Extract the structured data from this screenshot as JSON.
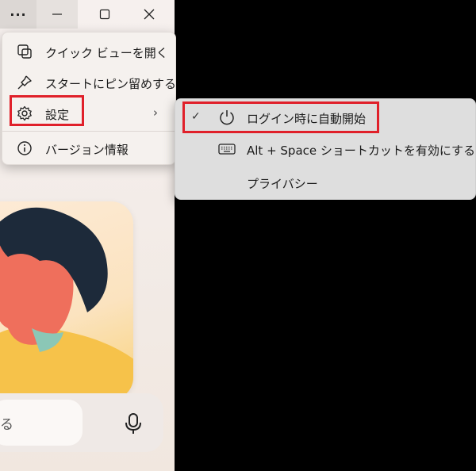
{
  "titlebar": {
    "more_label": "···",
    "minimize_label": "—",
    "maximize_label": "☐",
    "close_label": "✕"
  },
  "menu": {
    "items": [
      {
        "label": "クイック ビューを開く",
        "icon": "quick-view-icon"
      },
      {
        "label": "スタートにピン留めする",
        "icon": "pin-icon"
      },
      {
        "label": "設定",
        "icon": "gear-icon",
        "has_submenu": true
      },
      {
        "label": "バージョン情報",
        "icon": "info-icon"
      }
    ],
    "chevron": "›"
  },
  "submenu": {
    "items": [
      {
        "label": "ログイン時に自動開始",
        "icon": "power-icon",
        "checked": true,
        "check": "✓"
      },
      {
        "label": "Alt + Space ショートカットを有効にする",
        "icon": "keyboard-icon",
        "checked": false
      },
      {
        "label": "プライバシー",
        "icon": "",
        "checked": false
      }
    ]
  },
  "search": {
    "text": "る"
  },
  "colors": {
    "highlight_box": "#e0202a",
    "menu_bg": "#f5f1ee",
    "submenu_bg": "#dedede",
    "backdrop": "#000000"
  }
}
